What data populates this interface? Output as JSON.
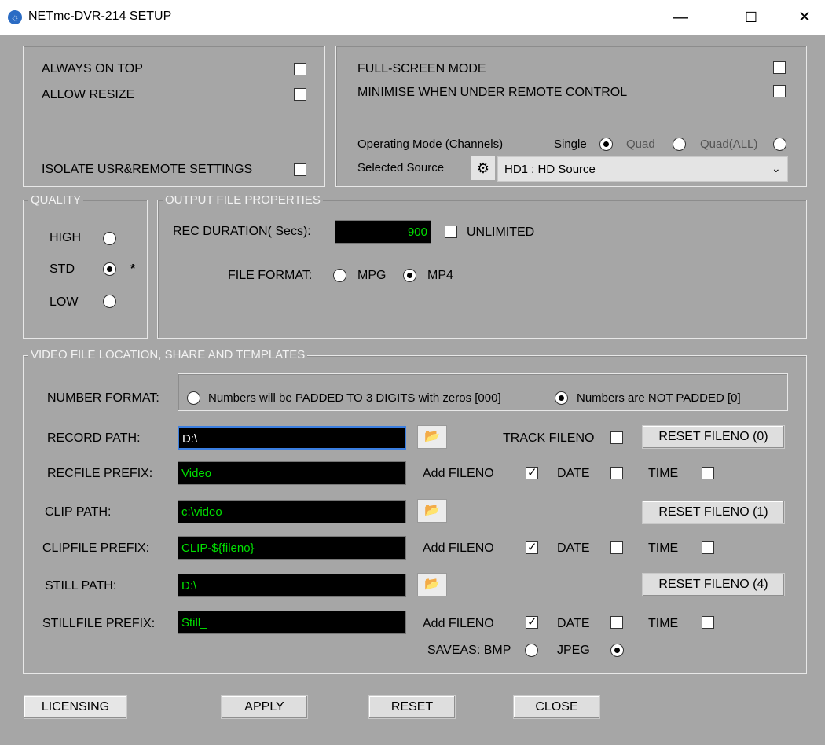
{
  "window": {
    "title": "NETmc-DVR-214 SETUP",
    "min": "—",
    "max": "☐",
    "close": "✕"
  },
  "general": {
    "always_on_top": "ALWAYS ON TOP",
    "allow_resize": "ALLOW RESIZE",
    "isolate": "ISOLATE USR&REMOTE SETTINGS",
    "full_screen": "FULL-SCREEN MODE",
    "minimise": "MINIMISE WHEN UNDER REMOTE CONTROL",
    "operating_mode": "Operating Mode (Channels)",
    "single": "Single",
    "quad": "Quad",
    "quad_all": "Quad(ALL)",
    "selected_source": "Selected Source",
    "source_value": "HD1 : HD Source"
  },
  "quality": {
    "legend": "QUALITY",
    "high": "HIGH",
    "std": "STD",
    "low": "LOW",
    "marker": "*"
  },
  "output": {
    "legend": "OUTPUT FILE PROPERTIES",
    "rec_duration": "REC DURATION( Secs):",
    "rec_value": "900",
    "unlimited": "UNLIMITED",
    "file_format": "FILE FORMAT:",
    "mpg": "MPG",
    "mp4": "MP4"
  },
  "video": {
    "legend": "VIDEO FILE LOCATION, SHARE AND TEMPLATES",
    "number_format": "NUMBER FORMAT:",
    "padded": "Numbers will be PADDED TO 3 DIGITS with zeros [000]",
    "not_padded": "Numbers are NOT PADDED [0]",
    "record_path": "RECORD PATH:",
    "record_path_value": "D:\\",
    "track_fileno": "TRACK FILENO",
    "reset0": "RESET FILENO (0)",
    "recfile_prefix": "RECFILE PREFIX:",
    "recfile_value": "Video_",
    "clip_path": "CLIP PATH:",
    "clip_path_value": "c:\\video",
    "reset1": "RESET FILENO (1)",
    "clipfile_prefix": "CLIPFILE PREFIX:",
    "clipfile_value": "CLIP-${fileno}",
    "still_path": "STILL PATH:",
    "still_path_value": "D:\\",
    "reset4": "RESET FILENO (4)",
    "stillfile_prefix": "STILLFILE PREFIX:",
    "stillfile_value": "Still_",
    "add_fileno": "Add FILENO",
    "date": "DATE",
    "time": "TIME",
    "saveas": "SAVEAS: BMP",
    "jpeg": "JPEG"
  },
  "footer": {
    "licensing": "LICENSING",
    "apply": "APPLY",
    "reset": "RESET",
    "close": "CLOSE"
  },
  "icons": {
    "folder": "folder-open-icon",
    "gear": "gear-icon",
    "dropdown": "chevron-down-icon"
  }
}
